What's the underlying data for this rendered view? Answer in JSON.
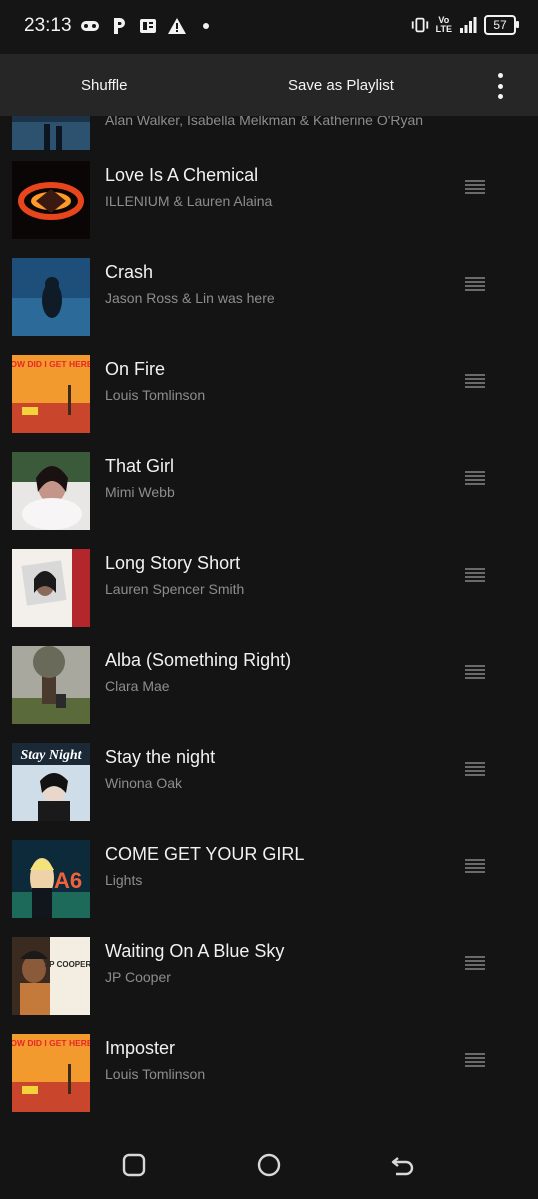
{
  "status_bar": {
    "time": "23:13",
    "battery": "57",
    "volte_top": "Vo",
    "volte_bottom": "LTE",
    "left_icons": [
      "gamepad-icon",
      "parking-icon",
      "news-icon",
      "warning-icon",
      "dot-icon"
    ],
    "right_icons": [
      "vibrate-icon",
      "volte-icon",
      "signal-icon",
      "battery-icon"
    ]
  },
  "toolbar": {
    "shuffle_label": "Shuffle",
    "save_playlist_label": "Save as Playlist",
    "more_icon": "more-vert-icon"
  },
  "tracks": [
    {
      "title": "",
      "artist": "Alan Walker, Isabella Melkman & Katherine O'Ryan"
    },
    {
      "title": "Love Is A Chemical",
      "artist": "ILLENIUM & Lauren Alaina"
    },
    {
      "title": "Crash",
      "artist": "Jason Ross & Lin was here"
    },
    {
      "title": "On Fire",
      "artist": "Louis Tomlinson"
    },
    {
      "title": "That Girl",
      "artist": "Mimi Webb"
    },
    {
      "title": "Long Story Short",
      "artist": "Lauren Spencer Smith"
    },
    {
      "title": "Alba (Something Right)",
      "artist": "Clara Mae"
    },
    {
      "title": "Stay the night",
      "artist": "Winona Oak"
    },
    {
      "title": "COME GET YOUR GIRL",
      "artist": "Lights"
    },
    {
      "title": "Waiting On A Blue Sky",
      "artist": "JP Cooper"
    },
    {
      "title": "Imposter",
      "artist": "Louis Tomlinson"
    }
  ],
  "art_text": {
    "on_fire": "HOW DID I GET HERE?",
    "stay_night": "Stay Night",
    "lights": "A6",
    "jp_cooper": "JP COOPER"
  },
  "nav_bar": {
    "icons": [
      "recents-icon",
      "home-icon",
      "back-icon"
    ]
  },
  "colors": {
    "background": "#141414",
    "toolbar": "#262626",
    "title": "#f1f1f1",
    "artist": "#8d8d8d",
    "drag_handle": "#6a6a6a"
  }
}
